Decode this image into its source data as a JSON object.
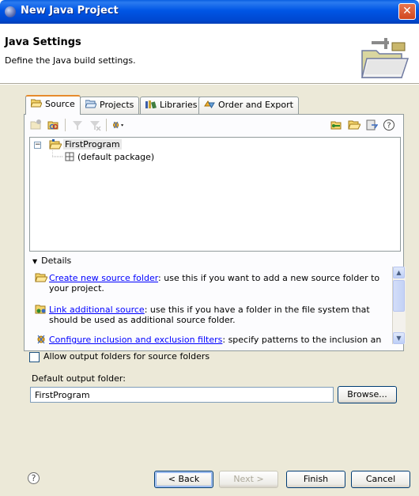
{
  "window": {
    "title": "New Java Project",
    "close_glyph": "✕"
  },
  "header": {
    "title": "Java Settings",
    "description": "Define the Java build settings."
  },
  "tabs": [
    {
      "label": "Source",
      "icon": "source-folder-icon",
      "active": true
    },
    {
      "label": "Projects",
      "icon": "projects-icon",
      "active": false
    },
    {
      "label": "Libraries",
      "icon": "libraries-icon",
      "active": false
    },
    {
      "label": "Order and Export",
      "icon": "order-export-icon",
      "active": false
    }
  ],
  "tree": {
    "project": "FirstProgram",
    "package": "(default package)",
    "expander": "−"
  },
  "details": {
    "toggle_label": "Details",
    "items": [
      {
        "link": "Create new source folder",
        "text": ": use this if you want to add a new source folder to your project."
      },
      {
        "link": "Link additional source",
        "text": ": use this if you have a folder in the file system that should be used as additional source folder."
      },
      {
        "link": "Configure inclusion and exclusion filters",
        "text": ": specify patterns to the inclusion and"
      }
    ]
  },
  "options": {
    "allow_output_folders_label": "Allow output folders for source folders",
    "allow_output_folders_checked": false,
    "default_output_label": "Default output folder:",
    "default_output_value": "FirstProgram",
    "browse_label": "Browse..."
  },
  "buttons": {
    "help": "?",
    "back": "< Back",
    "next": "Next >",
    "finish": "Finish",
    "cancel": "Cancel"
  },
  "colors": {
    "titlebar": "#0055e5",
    "dialog_bg": "#ece9d8",
    "active_tab_accent": "#e68b2c",
    "link": "#0000ff"
  }
}
